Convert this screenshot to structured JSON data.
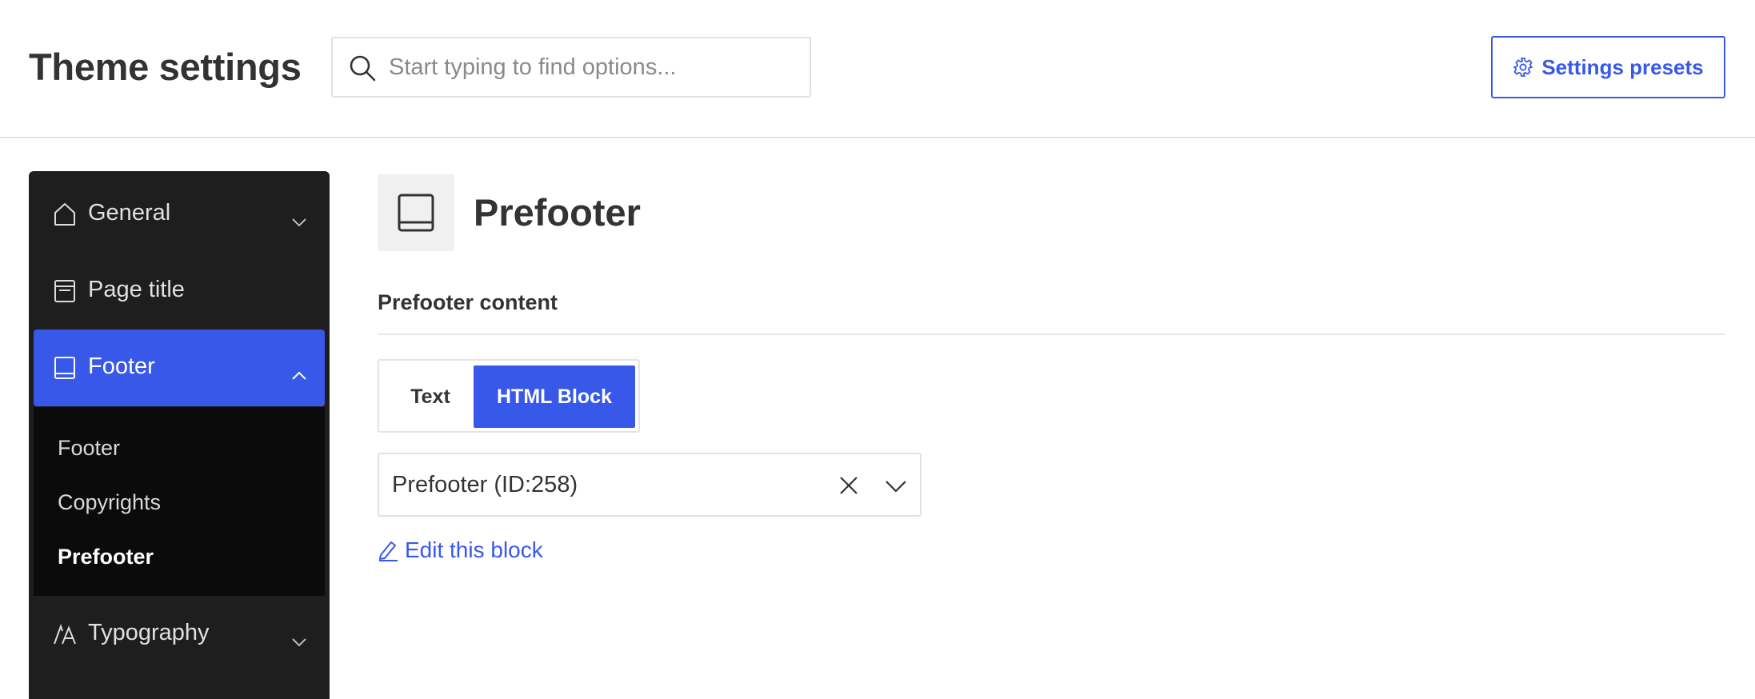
{
  "header": {
    "title": "Theme settings",
    "search_placeholder": "Start typing to find options...",
    "search_icon": "search-icon",
    "presets_label": "Settings presets",
    "presets_icon": "gear-icon"
  },
  "sidebar": {
    "items": [
      {
        "label": "General",
        "icon": "home-icon",
        "expanded": false
      },
      {
        "label": "Page title",
        "icon": "page-title-icon"
      },
      {
        "label": "Footer",
        "icon": "footer-icon",
        "expanded": true,
        "active": true
      },
      {
        "label": "Typography",
        "icon": "typography-icon",
        "expanded": false
      }
    ],
    "footer_submenu": [
      {
        "label": "Footer"
      },
      {
        "label": "Copyrights"
      },
      {
        "label": "Prefooter",
        "current": true
      }
    ]
  },
  "main": {
    "section_title": "Prefooter",
    "section_icon": "footer-icon",
    "field_title": "Prefooter content",
    "toggle": {
      "options": [
        "Text",
        "HTML Block"
      ],
      "selected": "HTML Block"
    },
    "select": {
      "value": "Prefooter (ID:258)"
    },
    "edit_link": "Edit this block"
  },
  "colors": {
    "accent": "#3858e9",
    "sidebar_bg": "#1e1e1e",
    "submenu_bg": "#0b0b0b",
    "text": "#333333"
  }
}
